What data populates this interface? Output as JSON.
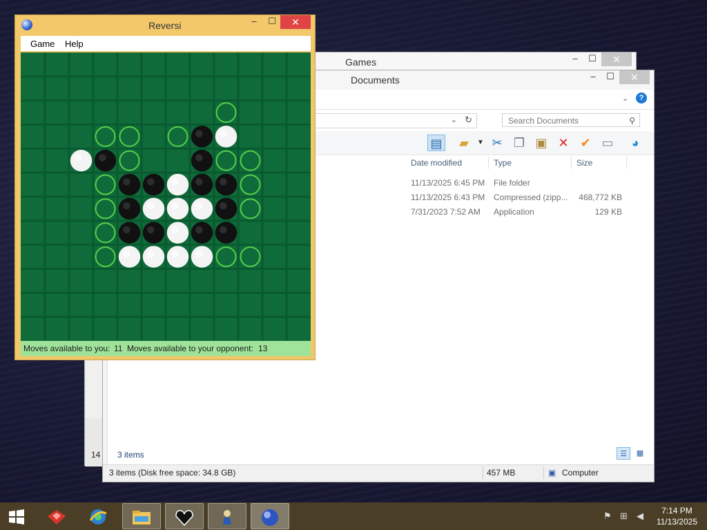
{
  "games_window": {
    "title": "Games",
    "side_count": "14"
  },
  "docs_window": {
    "title": "Documents",
    "search_placeholder": "Search Documents",
    "columns": {
      "date": "Date modified",
      "type": "Type",
      "size": "Size"
    },
    "rows": [
      {
        "date": "11/13/2025 6:45 PM",
        "type": "File folder",
        "size": ""
      },
      {
        "date": "11/13/2025 6:43 PM",
        "type": "Compressed (zipp...",
        "size": "468,772 KB"
      },
      {
        "date": "7/31/2023 7:52 AM",
        "type": "Application",
        "size": "129 KB"
      }
    ],
    "items_count": "3 items",
    "status": {
      "left": "3 items (Disk free space: 34.8 GB)",
      "size": "457 MB",
      "location": "Computer"
    }
  },
  "reversi": {
    "title": "Reversi",
    "menu": [
      "Game",
      "Help"
    ],
    "status_you_label": "Moves available to you:",
    "status_you_value": "11",
    "status_opp_label": "Moves available to your opponent:",
    "status_opp_value": "13",
    "board": [
      "............",
      "............",
      "........o...",
      "...oo.oBW...",
      "..WBo..Boo..",
      "...oBBWBBo..",
      "...oBWWWBo..",
      "...oBBWBB...",
      "...oWWWWoo..",
      "............",
      "............",
      "............"
    ],
    "colors": {
      "board": "#0f6b3a",
      "grid": "#0a5a2f",
      "hint": "#55d04a",
      "white": "#f4f4f4",
      "black": "#111111"
    }
  },
  "taskbar": {
    "time": "7:14 PM",
    "date": "11/13/2025"
  }
}
